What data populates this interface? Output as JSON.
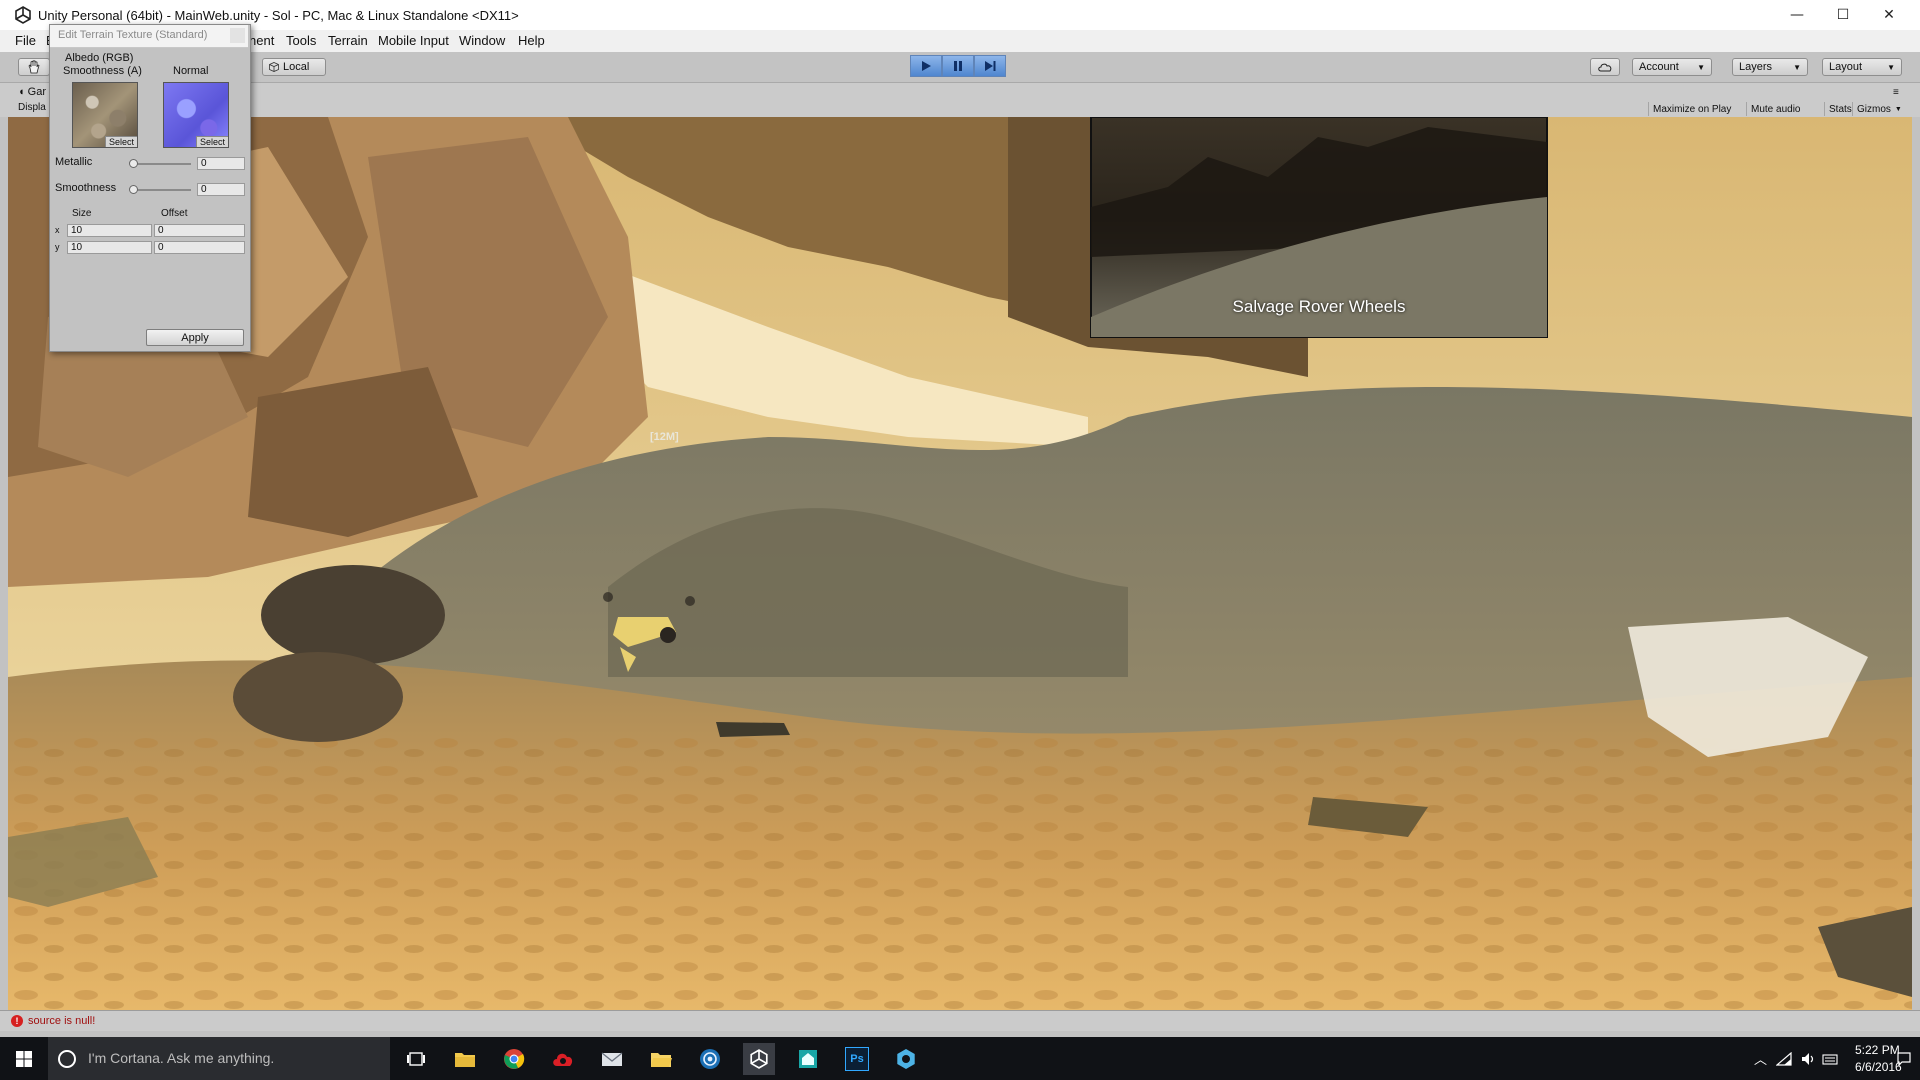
{
  "window": {
    "title": "Unity Personal (64bit) - MainWeb.unity - Sol - PC, Mac & Linux Standalone <DX11>",
    "controls": {
      "minimize": "—",
      "maximize": "☐",
      "close": "✕"
    }
  },
  "menu": {
    "file": "File",
    "edit_partial": "E",
    "component_partial": "nent",
    "tools": "Tools",
    "terrain": "Terrain",
    "mobile_input": "Mobile Input",
    "window": "Window",
    "help": "Help"
  },
  "toolbar": {
    "local": "Local",
    "account": "Account",
    "layers": "Layers",
    "layout": "Layout"
  },
  "game_view": {
    "tab_partial": "Gar",
    "display_partial": "Displa",
    "maximize_on_play": "Maximize on Play",
    "mute_audio": "Mute audio",
    "stats": "Stats",
    "gizmos": "Gizmos"
  },
  "dialog": {
    "title": "Edit Terrain Texture (Standard)",
    "albedo_label_line1": "Albedo (RGB)",
    "albedo_label_line2": "Smoothness (A)",
    "normal_label": "Normal",
    "select_label": "Select",
    "metallic_label": "Metallic",
    "metallic_value": "0",
    "metallic_level": 0,
    "smoothness_label": "Smoothness",
    "smoothness_value": "0",
    "smoothness_level": 0,
    "size_label": "Size",
    "offset_label": "Offset",
    "x_label": "x",
    "y_label": "y",
    "size_x": "10",
    "size_y": "10",
    "offset_x": "0",
    "offset_y": "0",
    "apply_label": "Apply"
  },
  "hud": {
    "objective": "Salvage Rover Wheels",
    "distance_marker": "[12M]"
  },
  "status": {
    "message": "source is null!"
  },
  "taskbar": {
    "cortana_placeholder": "I'm Cortana. Ask me anything.",
    "time": "5:22 PM",
    "date": "6/6/2016",
    "photoshop_label": "Ps"
  }
}
